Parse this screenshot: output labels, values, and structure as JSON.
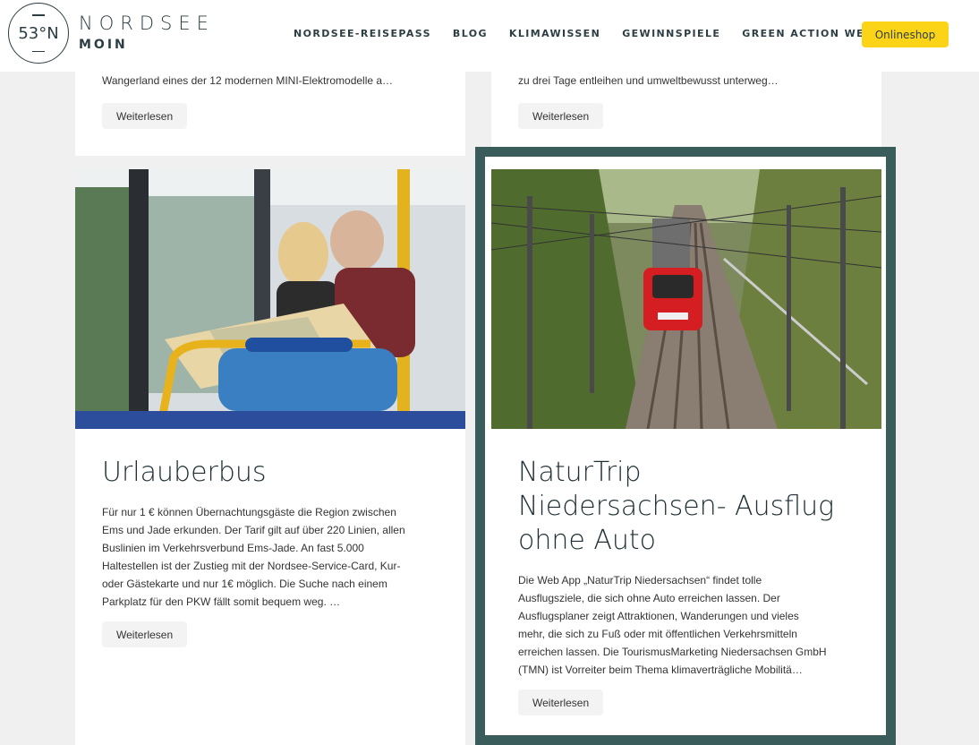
{
  "header": {
    "logo_badge": "53°N",
    "logo_main": "NORDSEE",
    "logo_sub": "MOIN",
    "nav": [
      "NORDSEE-REISEPASS",
      "BLOG",
      "KLIMAWISSEN",
      "GEWINNSPIELE",
      "GREEN ACTION WEEK"
    ],
    "shop_label": "Onlineshop"
  },
  "top_cards": [
    {
      "excerpt": "Wangerland eines der 12 modernen MINI-Elektromodelle a…",
      "button": "Weiterlesen"
    },
    {
      "excerpt": "zu drei Tage entleihen und umweltbewusst unterweg…",
      "button": "Weiterlesen"
    }
  ],
  "cards": [
    {
      "title": "Urlauberbus",
      "text_lines": [
        "Für nur 1 € können Übernachtungsgäste die Region zwischen",
        "Ems und Jade erkunden. Der Tarif gilt auf über 220 Linien, allen",
        "Buslinien im Verkehrsverbund Ems-Jade. An fast 5.000",
        "Haltestellen ist der Zustieg mit der Nordsee-Service-Card, Kur-",
        "oder Gästekarte und nur 1€ möglich. Die Suche nach einem",
        "Parkplatz für den PKW fällt somit bequem weg. …"
      ],
      "button": "Weiterlesen"
    },
    {
      "title_lines": [
        "NaturTrip",
        "Niedersachsen- Ausflug",
        "ohne Auto"
      ],
      "text_lines": [
        "Die Web App „NaturTrip Niedersachsen“ findet tolle",
        "Ausflugsziele, die sich ohne Auto erreichen lassen. Der",
        "Ausflugsplaner zeigt Attraktionen, Wanderungen und vieles",
        "mehr, die sich zu Fuß oder mit öffentlichen Verkehrsmitteln",
        "erreichen lassen. Die TourismusMarketing Niedersachsen GmbH",
        "(TMN) ist Vorreiter beim Thema klimaverträgliche Mobilitä…"
      ],
      "button": "Weiterlesen"
    }
  ],
  "colors": {
    "accent_frame": "#3a5c5a",
    "shop_button": "#fcd417",
    "brand_dark": "#2c3e44"
  }
}
